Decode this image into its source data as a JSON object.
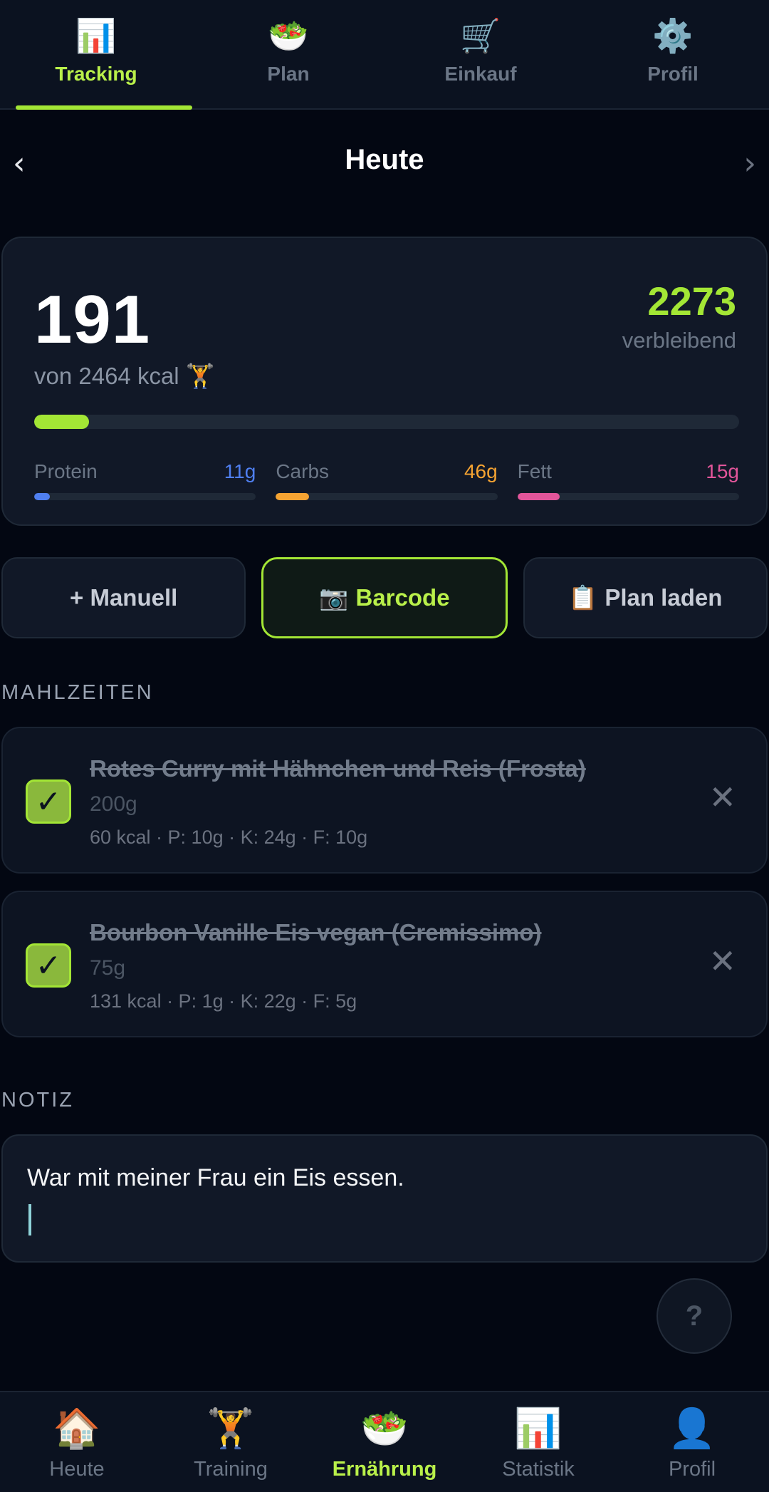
{
  "top_tabs": [
    {
      "icon": "📊",
      "icon_name": "bar-chart-icon",
      "label": "Tracking",
      "active": true
    },
    {
      "icon": "🥗",
      "icon_name": "salad-icon",
      "label": "Plan"
    },
    {
      "icon": "🛒",
      "icon_name": "cart-icon",
      "label": "Einkauf"
    },
    {
      "icon": "⚙️",
      "icon_name": "gear-icon",
      "label": "Profil"
    }
  ],
  "date": {
    "title": "Heute",
    "prev": "‹",
    "next": "›"
  },
  "calories": {
    "consumed": "191",
    "goal_text": "von 2464 kcal",
    "goal_emoji": "🏋️",
    "remaining": "2273",
    "remaining_label": "verbleibend",
    "progress_fraction": 0.0775
  },
  "macros": [
    {
      "name": "Protein",
      "value": "11g",
      "color": "#4f7ff0",
      "fraction": 0.07
    },
    {
      "name": "Carbs",
      "value": "46g",
      "color": "#f5a332",
      "fraction": 0.15
    },
    {
      "name": "Fett",
      "value": "15g",
      "color": "#e2559a",
      "fraction": 0.19
    }
  ],
  "actions": {
    "manual": "+ Manuell",
    "barcode_icon": "📷",
    "barcode": "Barcode",
    "plan_icon": "📋",
    "plan": "Plan laden"
  },
  "meals_label": "MAHLZEITEN",
  "meals": [
    {
      "title": "Rotes Curry mit Hähnchen und Reis (Frosta)",
      "amount": "200g",
      "nutrition": "60 kcal · P: 10g · K: 24g · F: 10g",
      "checked": "✓",
      "remove": "✕"
    },
    {
      "title": "Bourbon Vanille Eis vegan (Cremissimo)",
      "amount": "75g",
      "nutrition": "131 kcal · P: 1g · K: 22g · F: 5g",
      "checked": "✓",
      "remove": "✕"
    }
  ],
  "note_label": "NOTIZ",
  "note_text": "War mit meiner Frau ein Eis essen.",
  "help": "?",
  "bottom_nav": [
    {
      "icon": "🏠",
      "icon_name": "home-icon",
      "label": "Heute"
    },
    {
      "icon": "🏋️",
      "icon_name": "weightlifter-icon",
      "label": "Training"
    },
    {
      "icon": "🥗",
      "icon_name": "salad-icon",
      "label": "Ernährung",
      "active": true
    },
    {
      "icon": "📊",
      "icon_name": "bar-chart-icon",
      "label": "Statistik"
    },
    {
      "icon": "👤",
      "icon_name": "user-icon",
      "label": "Profil"
    }
  ],
  "colors": {
    "accent": "#a3e635",
    "background": "#030712",
    "card": "#111827"
  }
}
